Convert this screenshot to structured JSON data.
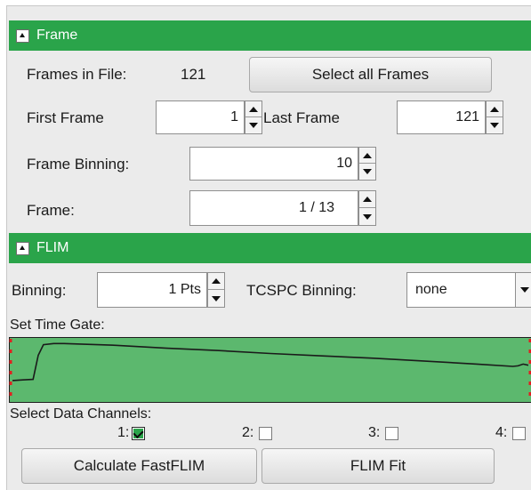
{
  "frame_section": {
    "title": "Frame",
    "frames_in_file_label": "Frames in File:",
    "frames_in_file_value": "121",
    "select_all_label": "Select all Frames",
    "first_frame_label": "First Frame",
    "first_frame_value": "1",
    "last_frame_label": "Last Frame",
    "last_frame_value": "121",
    "frame_binning_label": "Frame Binning:",
    "frame_binning_value": "10",
    "frame_label": "Frame:",
    "frame_value": "1 / 13"
  },
  "flim_section": {
    "title": "FLIM",
    "binning_label": "Binning:",
    "binning_value": "1 Pts",
    "tcspc_binning_label": "TCSPC Binning:",
    "tcspc_binning_value": "none",
    "time_gate_label": "Set Time Gate:",
    "data_channels_label": "Select Data Channels:",
    "channels": [
      {
        "label": "1:",
        "checked": true
      },
      {
        "label": "2:",
        "checked": false
      },
      {
        "label": "3:",
        "checked": false
      },
      {
        "label": "4:",
        "checked": false
      }
    ],
    "calculate_label": "Calculate FastFLIM",
    "flim_fit_label": "FLIM Fit"
  },
  "colors": {
    "header_green": "#2aa44a",
    "gate_fill": "#5cb86e",
    "marker_red": "#e02020"
  },
  "decay_curve": {
    "x": [
      0,
      0.02,
      0.04,
      0.05,
      0.06,
      0.08,
      0.1,
      0.2,
      0.3,
      0.4,
      0.5,
      0.6,
      0.7,
      0.8,
      0.9,
      0.97,
      0.98,
      0.99,
      1.0
    ],
    "y": [
      0.32,
      0.33,
      0.34,
      0.75,
      0.93,
      0.95,
      0.95,
      0.92,
      0.87,
      0.83,
      0.78,
      0.74,
      0.7,
      0.65,
      0.6,
      0.56,
      0.57,
      0.6,
      0.58
    ]
  }
}
